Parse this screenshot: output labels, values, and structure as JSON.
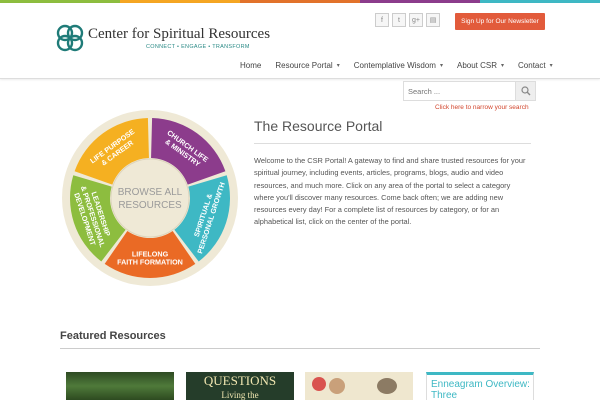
{
  "brand": {
    "name": "Center for Spiritual Resources",
    "tagline": "CONNECT • ENGAGE • TRANSFORM",
    "colors": {
      "teal": "#1f7b78",
      "accent": "#e25b3b"
    }
  },
  "top_stripe_colors": [
    "#8dbd3f",
    "#f5a623",
    "#e2722a",
    "#8c3c8c",
    "#3eb8c4"
  ],
  "social": [
    {
      "icon": "facebook-icon",
      "glyph": "f"
    },
    {
      "icon": "twitter-icon",
      "glyph": "t"
    },
    {
      "icon": "google-plus-icon",
      "glyph": "g+"
    },
    {
      "icon": "rss-icon",
      "glyph": "▤"
    }
  ],
  "newsletter_label": "Sign Up for Our Newsletter",
  "nav": [
    {
      "label": "Home",
      "has_menu": false
    },
    {
      "label": "Resource Portal",
      "has_menu": true
    },
    {
      "label": "Contemplative Wisdom",
      "has_menu": true
    },
    {
      "label": "About CSR",
      "has_menu": true
    },
    {
      "label": "Contact",
      "has_menu": true
    }
  ],
  "search": {
    "placeholder": "Search ...",
    "narrow_link": "Click here to narrow your search"
  },
  "portal": {
    "title": "The Resource Portal",
    "intro": "Welcome to the CSR Portal! A gateway to find and share trusted resources for your spiritual journey, including events, articles, programs, blogs, audio and video resources, and much more. Click on any area of the portal to select a category where you'll discover many resources. Come back often; we are adding new resources every day! For a complete list of resources by category, or for an alphabetical list, click on the center of the portal."
  },
  "wheel": {
    "center": [
      "BROWSE ALL",
      "RESOURCES"
    ],
    "segments": [
      {
        "label": [
          "LIFE PURPOSE",
          "& CAREER"
        ],
        "color": "#f5b021"
      },
      {
        "label": [
          "CHURCH LIFE",
          "& MINISTRY"
        ],
        "color": "#8c3c8c"
      },
      {
        "label": [
          "SPIRITUAL &",
          "PERSONAL GROWTH"
        ],
        "color": "#3eb8c4"
      },
      {
        "label": [
          "LIFELONG",
          "FAITH FORMATION"
        ],
        "color": "#ea6a25"
      },
      {
        "label": [
          "LEADERSHIP",
          "& PROFESSIONAL",
          "DEVELOPMENT"
        ],
        "color": "#8dbd3f"
      }
    ]
  },
  "featured": {
    "heading": "Featured Resources",
    "items": [
      {
        "title": ""
      },
      {
        "title": "QUESTIONS",
        "subtitle": "Living the"
      },
      {
        "title": ""
      },
      {
        "title": "Enneagram Overview: Three"
      }
    ]
  }
}
